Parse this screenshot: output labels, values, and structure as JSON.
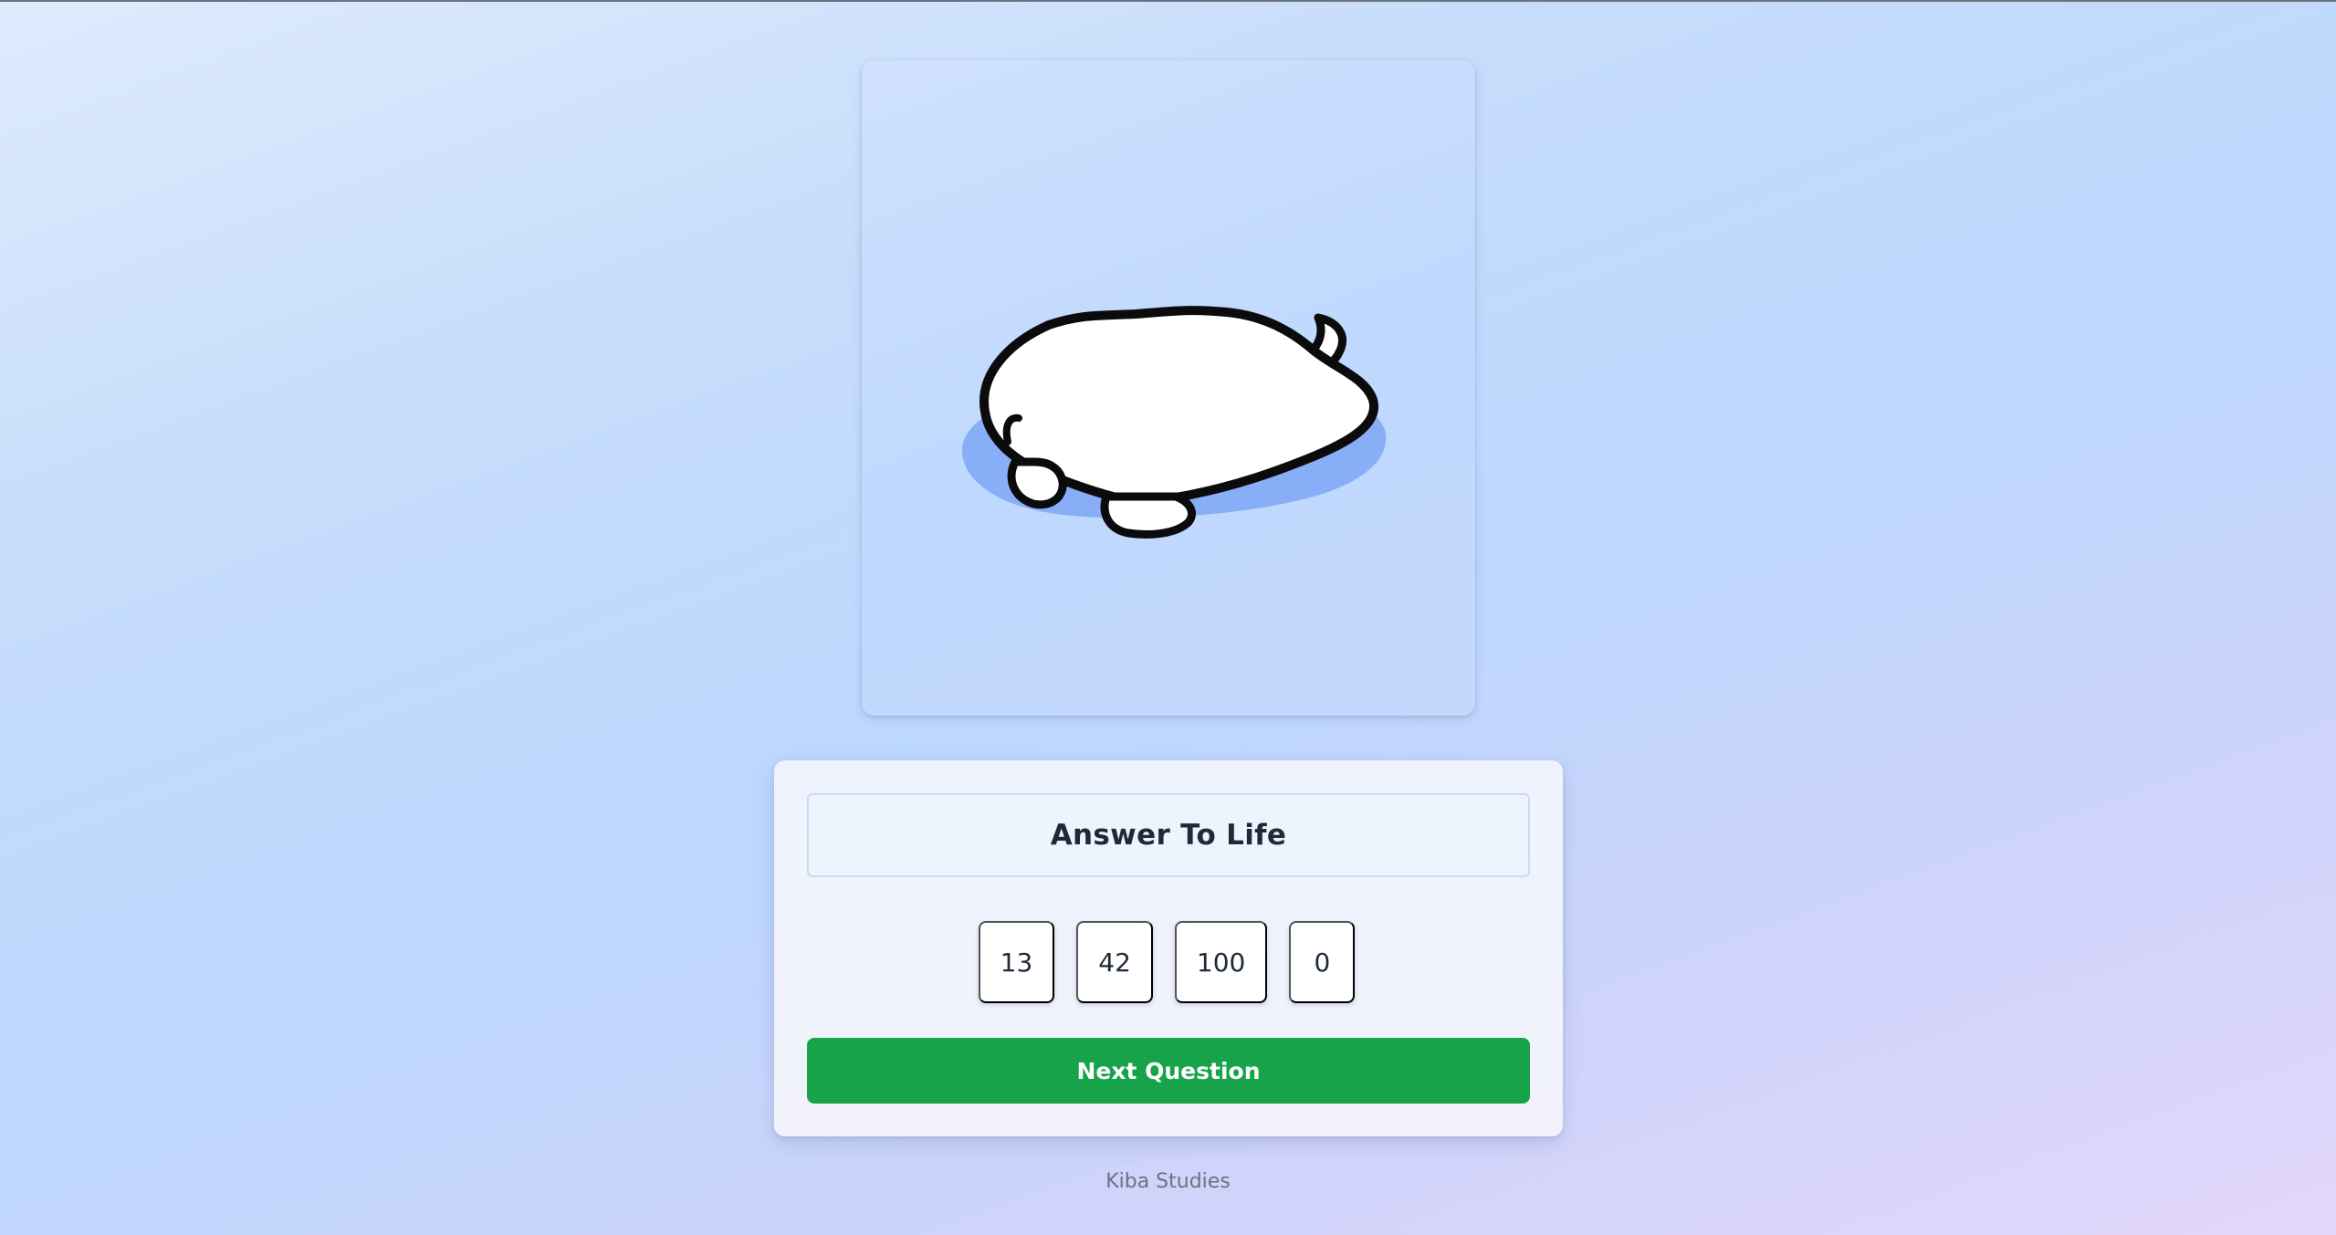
{
  "quiz": {
    "question": "Answer To Life",
    "options": [
      "13",
      "42",
      "100",
      "0"
    ],
    "next_label": "Next Question"
  },
  "illustration": {
    "name": "cat-lying-flat-icon",
    "colors": {
      "body": "#ffffff",
      "outline": "#0b0b0b",
      "shadow": "#87aef7"
    }
  },
  "footer": {
    "text": "Kiba Studies"
  },
  "colors": {
    "accent": "#16a34a",
    "question_border": "#c9dcf2",
    "page_gradient": [
      "#deebfd",
      "#bcd8fe",
      "#e3d6fc"
    ]
  }
}
